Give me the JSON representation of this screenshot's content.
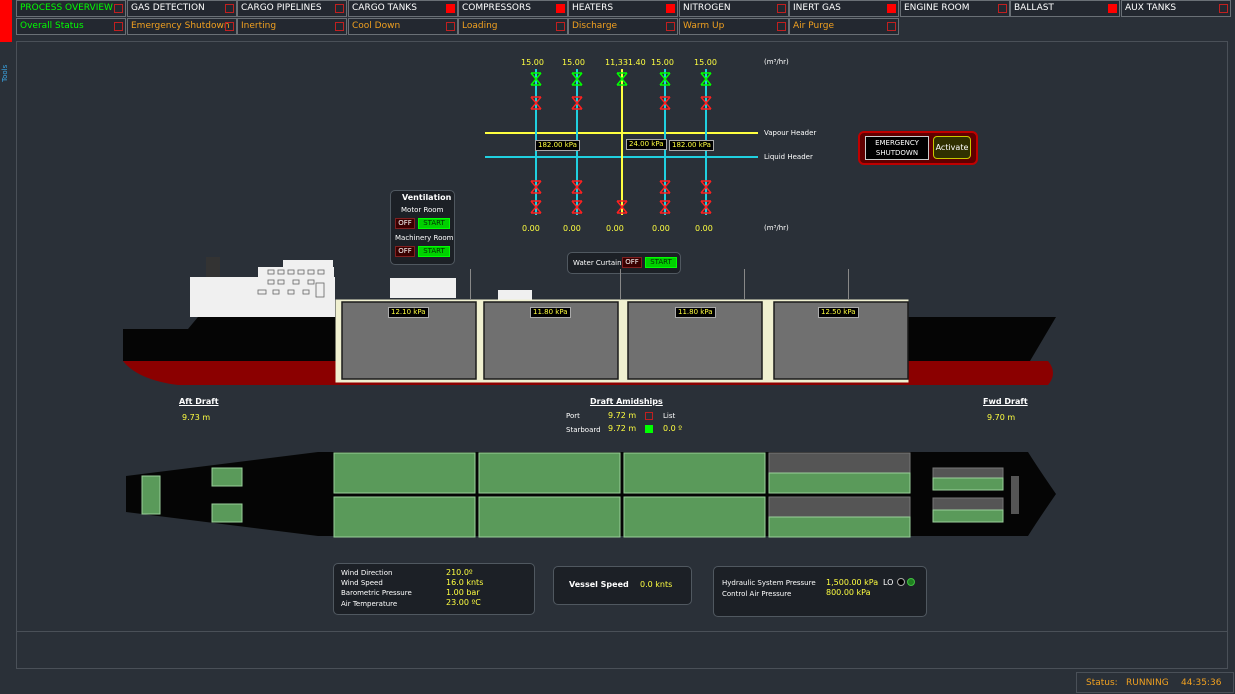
{
  "nav": {
    "row1": [
      {
        "label": "PROCESS OVERVIEW",
        "indicator": "off",
        "active": true
      },
      {
        "label": "GAS DETECTION",
        "indicator": "off"
      },
      {
        "label": "CARGO PIPELINES",
        "indicator": "off"
      },
      {
        "label": "CARGO TANKS",
        "indicator": "on"
      },
      {
        "label": "COMPRESSORS",
        "indicator": "on"
      },
      {
        "label": "HEATERS",
        "indicator": "on"
      },
      {
        "label": "NITROGEN",
        "indicator": "off"
      },
      {
        "label": "INERT GAS",
        "indicator": "on"
      },
      {
        "label": "ENGINE ROOM",
        "indicator": "off"
      },
      {
        "label": "BALLAST",
        "indicator": "on"
      },
      {
        "label": "AUX TANKS",
        "indicator": "off"
      }
    ],
    "row2": [
      {
        "label": "Overall Status",
        "indicator": "off",
        "active": true
      },
      {
        "label": "Emergency Shutdown",
        "indicator": "off"
      },
      {
        "label": "Inerting",
        "indicator": "off"
      },
      {
        "label": "Cool Down",
        "indicator": "off"
      },
      {
        "label": "Loading",
        "indicator": "off"
      },
      {
        "label": "Discharge",
        "indicator": "off"
      },
      {
        "label": "Warm Up",
        "indicator": "off"
      },
      {
        "label": "Air Purge",
        "indicator": "off"
      }
    ]
  },
  "side": {
    "tools_label": "Tools"
  },
  "manifold": {
    "top_flows": [
      "15.00",
      "15.00",
      "11,331.40",
      "15.00",
      "15.00"
    ],
    "bottom_flows": [
      "0.00",
      "0.00",
      "0.00",
      "0.00",
      "0.00"
    ],
    "unit": "(m³/hr)",
    "vapour_header": "Vapour Header",
    "liquid_header": "Liquid Header",
    "pressures": [
      "182.00 kPa",
      "24.00 kPa",
      "182.00 kPa"
    ]
  },
  "esd": {
    "title_line1": "EMERGENCY",
    "title_line2": "SHUTDOWN",
    "activate": "Activate"
  },
  "ventilation": {
    "title": "Ventilation",
    "motor_room": "Motor Room",
    "machinery_room": "Machinery Room",
    "off": "OFF",
    "start": "START"
  },
  "water_curtain": {
    "label": "Water Curtain",
    "off": "OFF",
    "start": "START"
  },
  "tanks": {
    "pressures": [
      "12.10 kPa",
      "11.80 kPa",
      "11.80 kPa",
      "12.50 kPa"
    ]
  },
  "drafts": {
    "aft_label": "Aft Draft",
    "aft_value": "9.73 m",
    "fwd_label": "Fwd Draft",
    "fwd_value": "9.70 m",
    "mid_label": "Draft Amidships",
    "port_label": "Port",
    "port_value": "9.72 m",
    "stbd_label": "Starboard",
    "stbd_value": "9.72 m",
    "list_label": "List",
    "list_value": "0.0 º"
  },
  "plan": {
    "tank_levels_top": [
      1,
      1,
      1,
      0.5
    ],
    "tank_levels_bottom": [
      1,
      1,
      1,
      0.5
    ]
  },
  "weather": {
    "wind_dir_label": "Wind Direction",
    "wind_dir": "210.0º",
    "wind_speed_label": "Wind Speed",
    "wind_speed": "16.0 knts",
    "baro_label": "Barometric Pressure",
    "baro": "1.00 bar",
    "air_temp_label": "Air Temperature",
    "air_temp": "23.00 ºC"
  },
  "vessel": {
    "speed_label": "Vessel Speed",
    "speed": "0.0 knts"
  },
  "hydraulic": {
    "hyd_label": "Hydraulic System Pressure",
    "hyd_value": "1,500.00 kPa",
    "lo": "LO",
    "air_label": "Control Air Pressure",
    "air_value": "800.00 kPa"
  },
  "status": {
    "label": "Status:",
    "value": "RUNNING",
    "time": "44:35:36"
  },
  "colors": {
    "accent_green": "#00ff00",
    "alarm_red": "#ff0000",
    "value_yellow": "#ffff40",
    "hull_red": "#8b0000"
  }
}
